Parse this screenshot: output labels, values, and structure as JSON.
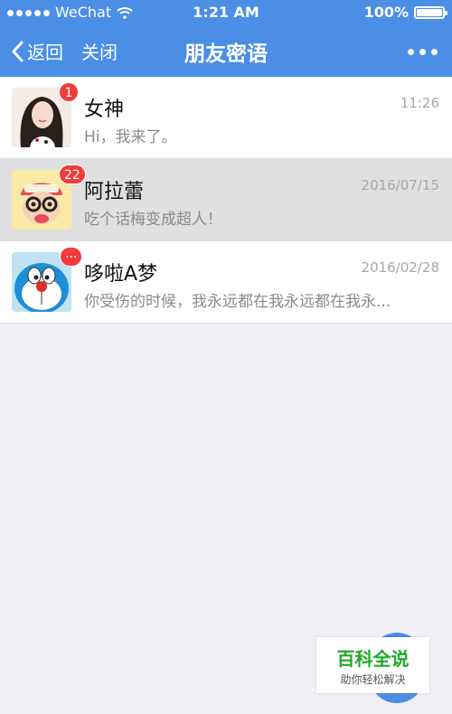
{
  "status": {
    "carrier": "WeChat",
    "time": "1:21 AM",
    "battery": "100%"
  },
  "nav": {
    "back_label": "返回",
    "close_label": "关闭",
    "title": "朋友密语"
  },
  "conversations": [
    {
      "name": "女神",
      "time": "11:26",
      "preview": "Hi，我来了。",
      "badge": "1"
    },
    {
      "name": "阿拉蕾",
      "time": "2016/07/15",
      "preview": "吃个话梅变成超人！",
      "badge": "22"
    },
    {
      "name": "哆啦A梦",
      "time": "2016/02/28",
      "preview": "你受伤的时候，我永远都在我永远都在我永...",
      "badge": "···"
    }
  ],
  "watermark": {
    "title": "百科全说",
    "subtitle": "助你轻松解决"
  },
  "colors": {
    "accent": "#4a8ee6",
    "badge": "#f23b3b",
    "background": "#efeff4"
  }
}
